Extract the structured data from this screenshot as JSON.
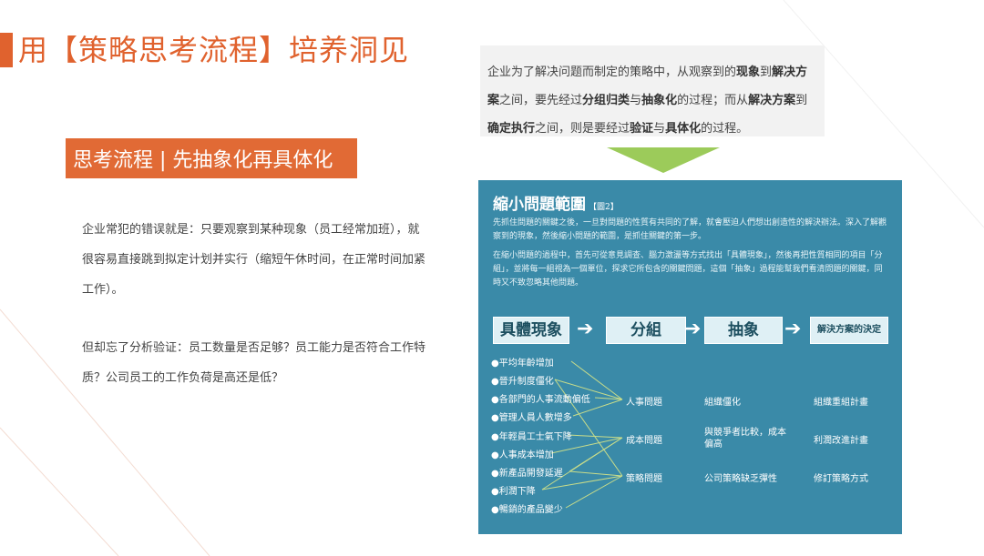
{
  "title": "用【策略思考流程】培养洞见",
  "subtitle": "思考流程 | 先抽象化再具体化",
  "body": {
    "p1": "企业常犯的错误就是：只要观察到某种现象（员工经常加班），就很容易直接跳到拟定计划并实行（缩短午休时间，在正常时间加紧工作）。",
    "p2": "但却忘了分析验证：员工数量是否足够？员工能力是否符合工作特质？公司员工的工作负荷是高还是低？"
  },
  "description": {
    "t1": "企业为了解决问题而制定的策略中，从观察到的",
    "b1": "现象",
    "t2": "到",
    "b2": "解决方案",
    "t3": "之间，要先经过",
    "b3": "分组归类",
    "t4": "与",
    "b4": "抽象化",
    "t5": "的过程；而从",
    "b5": "解决方案",
    "t6": "到",
    "b6": "确定执行",
    "t7": "之间，则是要经过",
    "b7": "验证",
    "t8": "与",
    "b8": "具体化",
    "t9": "的过程。"
  },
  "figure": {
    "title": "縮小問題範圍",
    "tag": "【圖2】",
    "para1": "先抓住問題的關鍵之後，一旦對問題的性質有共同的了解，就會壓迫人們想出創造性的解決辦法。深入了解觀察到的現象，然後縮小問題的範圍，是抓住關鍵的第一步。",
    "para2": "在縮小問題的過程中，首先可從意見調查、腦力激盪等方式找出「具體現象」，然後再把性質相同的項目「分組」，並將每一組視為一個單位，探求它所包含的關鍵問題，這個「抽象」過程能幫我們看清問題的關鍵，同時又不致忽略其他問題。",
    "steps": [
      "具體現象",
      "分組",
      "抽象",
      "解決方案的決定"
    ],
    "phenomena": [
      "●平均年齡增加",
      "●晉升制度僵化",
      "●各部門的人事流動偏低",
      "●管理人員人數增多",
      "●年輕員工士氣下降",
      "●人事成本增加",
      "●新產品開發延遲",
      "●利潤下降",
      "●暢銷的產品變少"
    ],
    "groups": [
      "人事問題",
      "成本問題",
      "策略問題"
    ],
    "abstractions": [
      "組織僵化",
      "與競爭者比較，成本偏高",
      "公司策略缺乏彈性"
    ],
    "solutions": [
      "組織重組計畫",
      "利潤改進計畫",
      "修訂策略方式"
    ]
  },
  "colors": {
    "accent": "#e0622e",
    "figure_bg": "#3a8aa8",
    "arrow_green": "#9ccb5a"
  }
}
